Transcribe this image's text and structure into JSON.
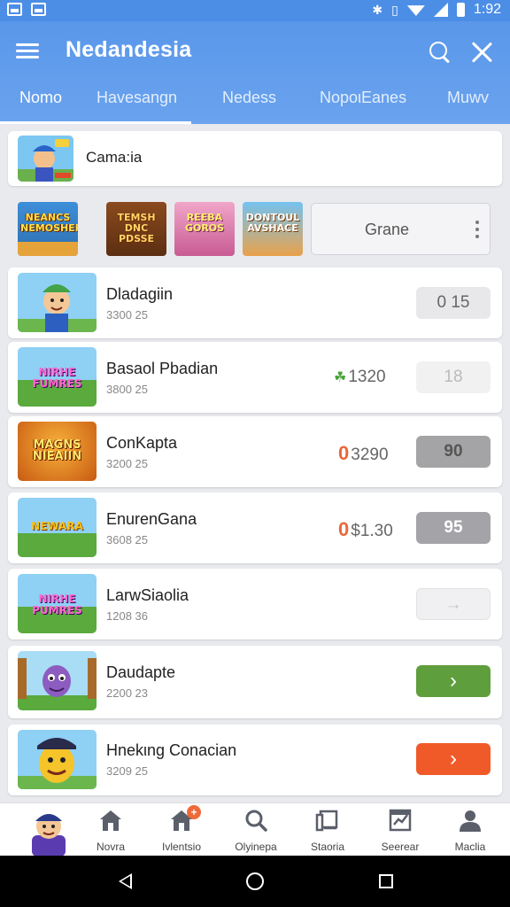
{
  "status_bar": {
    "time": "1:92"
  },
  "header": {
    "title": "Nedandesia",
    "tabs": [
      {
        "label": "Nomo"
      },
      {
        "label": "Havesangn"
      },
      {
        "label": "Nedess"
      },
      {
        "label": "NopoιEanes"
      },
      {
        "label": "Muwv"
      }
    ]
  },
  "featured": {
    "title": "Cama:ia"
  },
  "thumbnails": [
    {
      "caption": "NEANCS NEMOSHER"
    },
    {
      "caption": "TEMSH DNC PDSSE"
    },
    {
      "caption": "REEBA GOROS"
    },
    {
      "caption": "DONTOUL AVSHACE"
    }
  ],
  "grane_button": {
    "label": "Grane"
  },
  "games": [
    {
      "name": "Dladagiin",
      "sub": "3300 25",
      "price": "",
      "price_icon": "",
      "btn": "0 15",
      "thumb_text": ""
    },
    {
      "name": "Basaol Pbadian",
      "sub": "3800 25",
      "price": "1320",
      "price_icon": "☘",
      "btn": "18",
      "thumb_text": "NIRHE FUMRES"
    },
    {
      "name": "ConKapta",
      "sub": "3200 25",
      "price": "3290",
      "price_icon": "0",
      "btn": "90",
      "thumb_text": "MAGNS NIEAIIN"
    },
    {
      "name": "EnurenGana",
      "sub": "3608 25",
      "price": "$1.30",
      "price_icon": "0",
      "btn": "95",
      "thumb_text": "NEWARA"
    },
    {
      "name": "LarwSiaolia",
      "sub": "1208 36",
      "price": "",
      "price_icon": "",
      "btn": "→",
      "thumb_text": "NIRHE PUMRES"
    },
    {
      "name": "Daudapte",
      "sub": "2200 23",
      "price": "",
      "price_icon": "",
      "btn": "›",
      "thumb_text": ""
    },
    {
      "name": "Hnekιng Conacian",
      "sub": "3209 25",
      "price": "",
      "price_icon": "",
      "btn": "›",
      "thumb_text": ""
    }
  ],
  "bottom_nav": [
    {
      "label": "Novra",
      "icon": "home-icon"
    },
    {
      "label": "Ivlentsio",
      "icon": "home-badge-icon",
      "badge": "+"
    },
    {
      "label": "Olyinepa",
      "icon": "search-icon"
    },
    {
      "label": "Staoria",
      "icon": "book-icon"
    },
    {
      "label": "Seerear",
      "icon": "chart-icon"
    },
    {
      "label": "Maclia",
      "icon": "person-icon"
    }
  ],
  "colors": {
    "app_bar": "#5a97ea",
    "accent_red": "#ef4a4a",
    "accent_orange": "#e8683a",
    "green_button": "#5f9e3c",
    "orange_button": "#f05a28"
  }
}
